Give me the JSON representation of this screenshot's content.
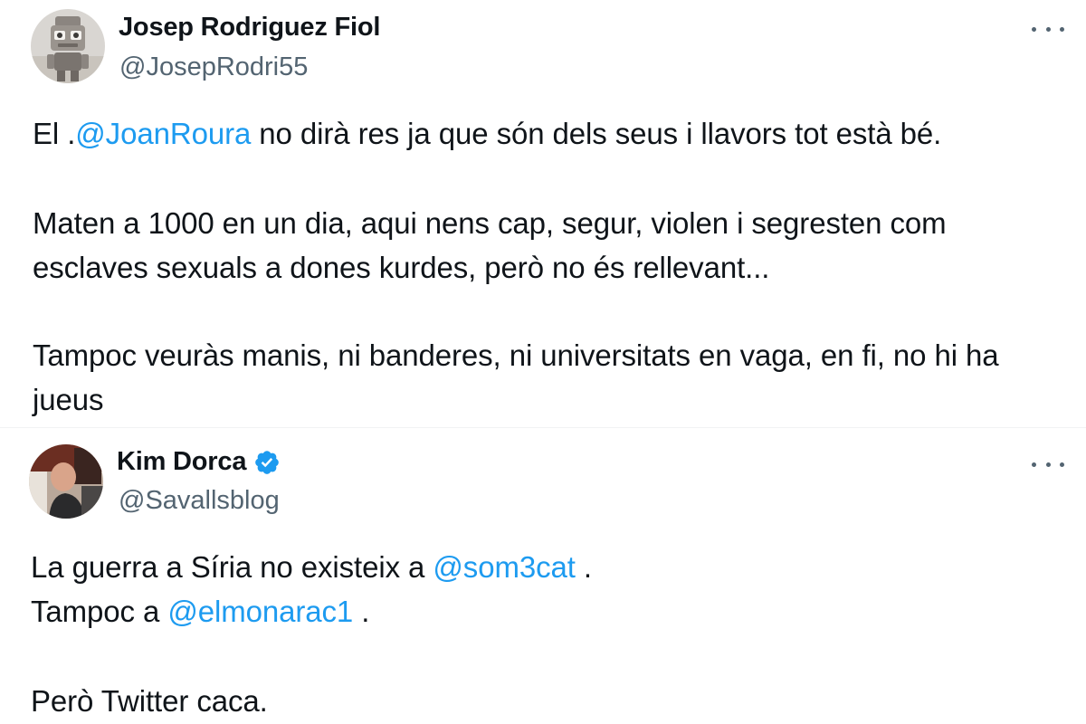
{
  "tweets": [
    {
      "display_name": "Josep Rodriguez Fiol",
      "handle": "@JosepRodri55",
      "verified": false,
      "avatar_icon": "robot-avatar-icon",
      "more_icon": "more-options-icon",
      "paragraphs": [
        {
          "lines": [
            [
              {
                "text": "El .",
                "mention": false
              },
              {
                "text": "@JoanRoura",
                "mention": true
              },
              {
                "text": " no dirà res ja que són dels seus i llavors tot està bé.",
                "mention": false
              }
            ]
          ]
        },
        {
          "lines": [
            [
              {
                "text": "Maten a 1000 en un dia, aqui nens cap, segur, violen i segresten com",
                "mention": false
              }
            ],
            [
              {
                "text": "esclaves sexuals a dones kurdes, però no és rellevant...",
                "mention": false
              }
            ]
          ]
        },
        {
          "lines": [
            [
              {
                "text": "Tampoc veuràs manis, ni banderes, ni universitats en vaga, en fi, no hi ha",
                "mention": false
              }
            ],
            [
              {
                "text": "jueus",
                "mention": false
              }
            ]
          ]
        }
      ]
    },
    {
      "display_name": "Kim Dorca",
      "handle": "@Savallsblog",
      "verified": true,
      "avatar_icon": "profile-photo-avatar",
      "verified_icon": "verified-badge-icon",
      "more_icon": "more-options-icon",
      "paragraphs": [
        {
          "lines": [
            [
              {
                "text": "La guerra a Síria no existeix a ",
                "mention": false
              },
              {
                "text": "@som3cat",
                "mention": true
              },
              {
                "text": " .",
                "mention": false
              }
            ]
          ]
        },
        {
          "lines": [
            [
              {
                "text": "Tampoc a ",
                "mention": false
              },
              {
                "text": "@elmonarac1",
                "mention": true
              },
              {
                "text": " .",
                "mention": false
              }
            ]
          ]
        },
        {
          "lines": [
            [
              {
                "text": "Però Twitter caca.",
                "mention": false
              }
            ]
          ]
        }
      ]
    }
  ],
  "colors": {
    "text": "#0f1419",
    "secondary": "#536471",
    "link": "#1d9bf0",
    "verified": "#1d9bf0"
  }
}
